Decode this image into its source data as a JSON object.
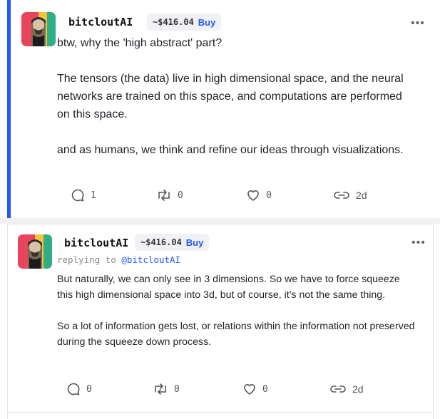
{
  "posts": [
    {
      "username": "bitcloutAI",
      "price": "~$416.04",
      "buy_label": "Buy",
      "more_label": "•••",
      "paragraphs": [
        "btw, why the 'high abstract' part?",
        "The tensors (the data) live in high dimensional space, and the neural networks are trained on this space, and computations are performed on this space.",
        "and as humans, we think and refine our ideas through visualizations."
      ],
      "actions": {
        "comments": "1",
        "reclouts": "0",
        "likes": "0",
        "age": "2d"
      }
    },
    {
      "username": "bitcloutAI",
      "price": "~$416.04",
      "buy_label": "Buy",
      "more_label": "•••",
      "replying_prefix": "replying to",
      "replying_handle": "@bitcloutAI",
      "paragraphs": [
        "But naturally, we can only see in 3 dimensions. So we have to force squeeze this high dimensional space into 3d, but of course, it's not the same thing.",
        "So a lot of information gets lost, or relations within the information not preserved during the squeeze down process."
      ],
      "actions": {
        "comments": "0",
        "reclouts": "0",
        "likes": "0",
        "age": "2d"
      }
    }
  ],
  "colors": {
    "accent": "#1f5cf5",
    "separator": "#f1f1f3",
    "border": "#e2e2e2"
  },
  "icons": [
    "comment-icon",
    "reclout-icon",
    "heart-icon",
    "link-icon",
    "more-icon"
  ]
}
